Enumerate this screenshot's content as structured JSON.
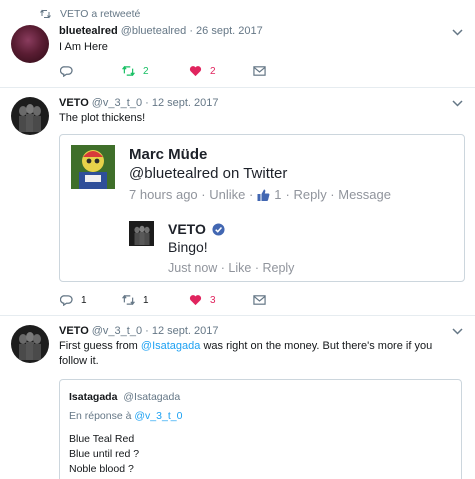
{
  "colors": {
    "accent": "#1da1f2",
    "retweet": "#17bf63",
    "like": "#e0245e",
    "muted": "#657786"
  },
  "tweets": [
    {
      "context": "VETO a retweeté",
      "name": "bluetealred",
      "meta": "@bluetealred · 26 sept. 2017",
      "text": "I Am Here",
      "replies": "",
      "retweets": "2",
      "likes": "2",
      "retweeted": true,
      "liked": true
    },
    {
      "name": "VETO",
      "meta": "@v_3_t_0 · 12 sept. 2017",
      "text": "The plot thickens!",
      "replies": "1",
      "retweets": "1",
      "likes": "3",
      "liked": true,
      "embed": {
        "name": "Marc Müde",
        "handle": "@bluetealred on Twitter",
        "time": "7 hours ago · Unlike ·",
        "like_count": "1",
        "actions": "· Reply · Message",
        "reply_name": "VETO",
        "reply_text": "Bingo!",
        "reply_meta": "Just now · Like · Reply"
      }
    },
    {
      "name": "VETO",
      "meta": "@v_3_t_0 · 12 sept. 2017",
      "text_before": "First guess from ",
      "text_mention": "@Isatagada",
      "text_after": " was right on the money. But there's more if you follow it.",
      "quote": {
        "name": "Isatagada",
        "handle": "@Isatagada",
        "reply_prefix": "En réponse à ",
        "reply_to": "@v_3_t_0",
        "lines": [
          "Blue Teal Red",
          "Blue until red ?",
          "Noble blood ?"
        ]
      }
    }
  ]
}
